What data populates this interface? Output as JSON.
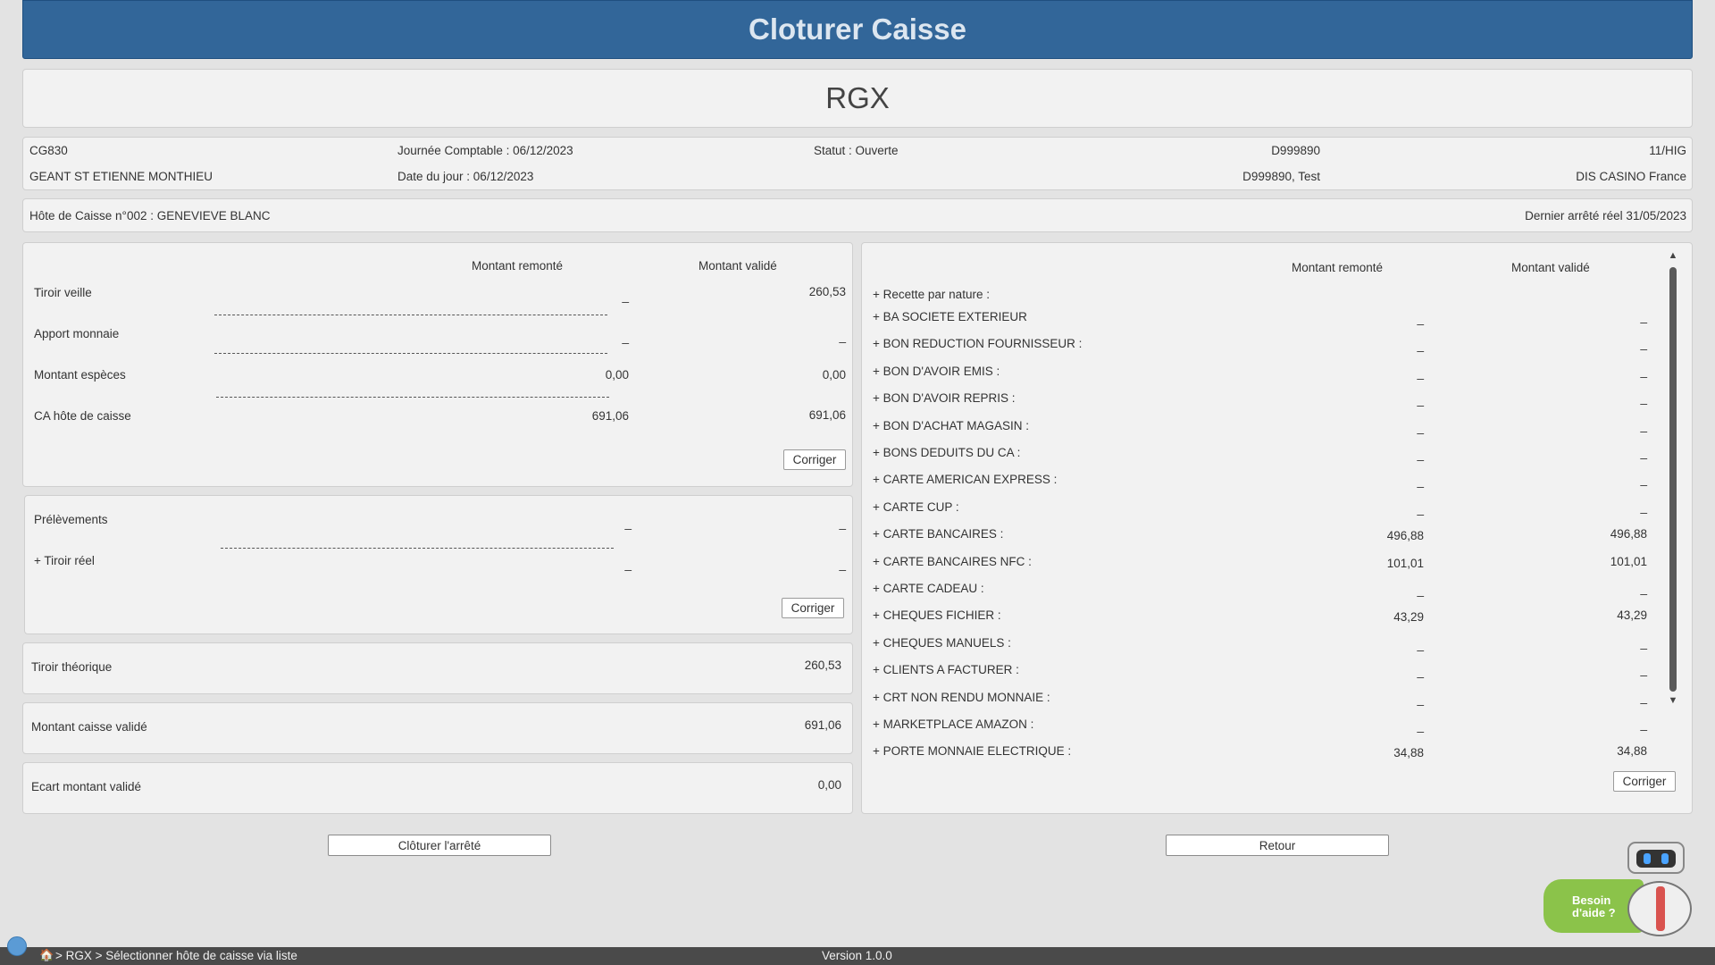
{
  "header": {
    "title": "Cloturer Caisse"
  },
  "store": {
    "name": "RGX"
  },
  "info": {
    "code": "CG830",
    "journee_comptable": "Journée Comptable : 06/12/2023",
    "statut": "Statut : Ouverte",
    "id": "D999890",
    "ref": "11/HIG",
    "magasin": "GEANT ST ETIENNE MONTHIEU",
    "date_du_jour": "Date du jour : 06/12/2023",
    "user": "D999890, Test",
    "societe": "DIS CASINO France"
  },
  "host": {
    "label": "Hôte de Caisse n°002 : GENEVIEVE BLANC",
    "dernier_arrete": "Dernier arrêté réel 31/05/2023"
  },
  "drawer": {
    "col_remonte": "Montant remonté",
    "col_valide": "Montant validé",
    "rows": [
      {
        "label": "Tiroir veille",
        "remonte": "_",
        "valide": "260,53"
      },
      {
        "label": "Apport monnaie",
        "remonte": "_",
        "valide": "_"
      },
      {
        "label": "Montant espèces",
        "remonte": "0,00",
        "valide": "0,00"
      },
      {
        "label": "CA hôte de caisse",
        "remonte": "691,06",
        "valide": "691,06"
      }
    ],
    "button": "Corriger"
  },
  "withdraw": {
    "rows": [
      {
        "label": "Prélèvements",
        "remonte": "_",
        "valide": "_"
      },
      {
        "label": "+ Tiroir réel",
        "remonte": "_",
        "valide": "_"
      }
    ],
    "button": "Corriger"
  },
  "summary": {
    "theo": {
      "label": "Tiroir théorique",
      "value": "260,53"
    },
    "validated": {
      "label": "Montant caisse validé",
      "value": "691,06"
    },
    "gap": {
      "label": "Ecart montant validé",
      "value": "0,00"
    }
  },
  "nature": {
    "col_remonte": "Montant remonté",
    "col_valide": "Montant validé",
    "heading": "+ Recette par nature :",
    "rows": [
      {
        "label": "+ BA SOCIETE EXTERIEUR",
        "remonte": "_",
        "valide": "_"
      },
      {
        "label": "+ BON REDUCTION FOURNISSEUR :",
        "remonte": "_",
        "valide": "_"
      },
      {
        "label": "+ BON D'AVOIR EMIS :",
        "remonte": "_",
        "valide": "_"
      },
      {
        "label": "+ BON D'AVOIR REPRIS :",
        "remonte": "_",
        "valide": "_"
      },
      {
        "label": "+ BON D'ACHAT MAGASIN :",
        "remonte": "_",
        "valide": "_"
      },
      {
        "label": "+ BONS DEDUITS DU CA :",
        "remonte": "_",
        "valide": "_"
      },
      {
        "label": "+ CARTE AMERICAN EXPRESS :",
        "remonte": "_",
        "valide": "_"
      },
      {
        "label": "+ CARTE CUP :",
        "remonte": "_",
        "valide": "_"
      },
      {
        "label": "+ CARTE BANCAIRES :",
        "remonte": "496,88",
        "valide": "496,88"
      },
      {
        "label": "+ CARTE BANCAIRES NFC :",
        "remonte": "101,01",
        "valide": "101,01"
      },
      {
        "label": "+ CARTE CADEAU :",
        "remonte": "_",
        "valide": "_"
      },
      {
        "label": "+ CHEQUES FICHIER :",
        "remonte": "43,29",
        "valide": "43,29"
      },
      {
        "label": "+ CHEQUES MANUELS :",
        "remonte": "_",
        "valide": "_"
      },
      {
        "label": "+ CLIENTS A FACTURER :",
        "remonte": "_",
        "valide": "_"
      },
      {
        "label": "+ CRT NON RENDU MONNAIE :",
        "remonte": "_",
        "valide": "_"
      },
      {
        "label": "+ MARKETPLACE AMAZON :",
        "remonte": "_",
        "valide": "_"
      },
      {
        "label": "+ PORTE MONNAIE ELECTRIQUE :",
        "remonte": "34,88",
        "valide": "34,88"
      }
    ],
    "button": "Corriger"
  },
  "actions": {
    "close_label": "Clôturer l'arrêté",
    "back_label": "Retour"
  },
  "help": {
    "label": "Besoin d'aide ?",
    "icon": "robot-icon"
  },
  "status": {
    "breadcrumb": "> RGX > Sélectionner hôte de caisse via liste",
    "version": "Version 1.0.0",
    "home_icon": "home-icon"
  }
}
